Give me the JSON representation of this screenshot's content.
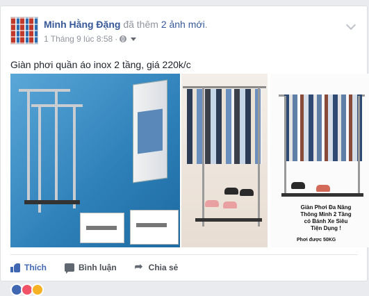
{
  "post": {
    "author": "Minh Hằng Đặng",
    "action_text": "đã thêm",
    "action_link": "2 ảnh mới",
    "action_suffix": ".",
    "timestamp": "1 Tháng 9 lúc 8:58",
    "separator": "·",
    "text": "Giàn phơi quần áo inox 2 tầng, giá 220k/c"
  },
  "photos": {
    "promo_lines": [
      "Giàn Phơi Đa Năng",
      "Thông Minh 2 Tầng",
      "có Bánh Xe Siêu",
      "Tiện Dụng !"
    ],
    "promo_sub": "Phơi được 50KG"
  },
  "actions": {
    "like": "Thích",
    "comment": "Bình luận",
    "share": "Chia sẻ"
  },
  "colors": {
    "link": "#365899",
    "like": "#4267b2",
    "meta": "#90949c"
  },
  "icons": [
    "globe-icon",
    "chevron-down-icon",
    "like-icon",
    "comment-icon",
    "share-icon"
  ]
}
